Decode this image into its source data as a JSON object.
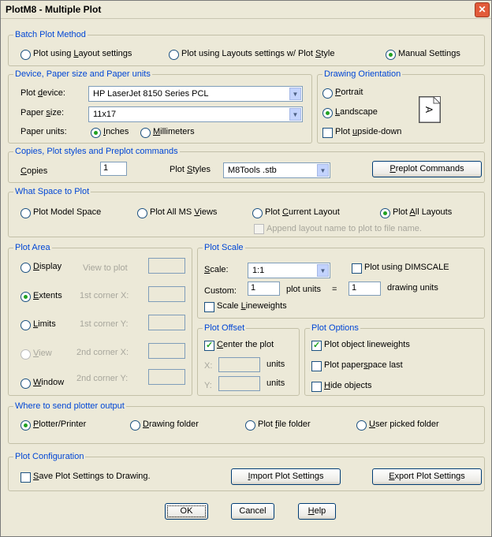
{
  "window": {
    "title": "PlotM8 - Multiple Plot"
  },
  "batch": {
    "legend": "Batch Plot Method",
    "opt1": [
      "Plot using ",
      "L",
      "ayout settings"
    ],
    "opt2": [
      "Plot using Layouts settings w/ Plot ",
      "S",
      "tyle"
    ],
    "opt3": "Manual Settings"
  },
  "device": {
    "legend": "Device, Paper size and Paper units",
    "plot_device_label": [
      "Plot ",
      "d",
      "evice:"
    ],
    "plot_device_value": "HP LaserJet 8150 Series PCL",
    "paper_size_label": [
      "Paper ",
      "s",
      "ize:"
    ],
    "paper_size_value": "11x17",
    "paper_units_label": "Paper units:",
    "inches": [
      "",
      "I",
      "nches"
    ],
    "millimeters": [
      "",
      "M",
      "illimeters"
    ]
  },
  "orientation": {
    "legend": "Drawing Orientation",
    "portrait": [
      "",
      "P",
      "ortrait"
    ],
    "landscape": [
      "",
      "L",
      "andscape"
    ],
    "upside_down": [
      "Plot ",
      "u",
      "pside-down"
    ],
    "icon_glyph": "A"
  },
  "copies": {
    "legend": "Copies, Plot styles and Preplot commands",
    "copies_label": [
      "",
      "C",
      "opies"
    ],
    "copies_value": "1",
    "styles_label": [
      "Plot ",
      "S",
      "tyles"
    ],
    "styles_value": "M8Tools .stb",
    "preplot": [
      "",
      "P",
      "replot Commands"
    ]
  },
  "space": {
    "legend": "What Space to Plot",
    "model": "Plot Model Space",
    "ms_views": [
      "Plot All MS ",
      "V",
      "iews"
    ],
    "current": [
      "Plot ",
      "C",
      "urrent Layout"
    ],
    "all": [
      "Plot ",
      "A",
      "ll Layouts"
    ],
    "append": "Append layout name to plot to file name."
  },
  "area": {
    "legend": "Plot Area",
    "display": [
      "",
      "D",
      "isplay"
    ],
    "extents": [
      "",
      "E",
      "xtents"
    ],
    "limits": [
      "",
      "L",
      "imits"
    ],
    "view": [
      "",
      "V",
      "iew"
    ],
    "window": [
      "",
      "W",
      "indow"
    ],
    "view_to_plot": "View to plot",
    "first_x": "1st corner X:",
    "first_y": "1st corner Y:",
    "second_x": "2nd corner X:",
    "second_y": "2nd corner Y:"
  },
  "scale": {
    "legend": "Plot Scale",
    "scale_label": [
      "",
      "S",
      "cale:"
    ],
    "scale_value": "1:1",
    "dimscale": "Plot using DIMSCALE",
    "custom_label": "Custom:",
    "custom_value": "1",
    "plot_units": "plot units",
    "equals": "=",
    "drawing_value": "1",
    "drawing_units": "drawing units",
    "lineweights": [
      "Scale ",
      "L",
      "ineweights"
    ]
  },
  "offset": {
    "legend": "Plot Offset",
    "center": [
      "",
      "C",
      "enter the plot"
    ],
    "x_label": "X:",
    "y_label": "Y:",
    "units": "units"
  },
  "options": {
    "legend": "Plot Options",
    "lineweights": "Plot object lineweights",
    "paperspace": [
      "Plot paper",
      "s",
      "pace last"
    ],
    "hide": [
      "",
      "H",
      "ide objects"
    ]
  },
  "output": {
    "legend": "Where to send plotter output",
    "printer": [
      "",
      "P",
      "lotter/Printer"
    ],
    "drawing_folder": [
      "",
      "D",
      "rawing folder"
    ],
    "file_folder": [
      "Plot ",
      "f",
      "ile folder"
    ],
    "user_folder": [
      "",
      "U",
      "ser picked folder"
    ]
  },
  "config": {
    "legend": "Plot Configuration",
    "save": [
      "",
      "S",
      "ave Plot Settings to Drawing."
    ],
    "import": [
      "",
      "I",
      "mport Plot Settings"
    ],
    "export": [
      "",
      "E",
      "xport Plot Settings"
    ]
  },
  "buttons": {
    "ok": "OK",
    "cancel": "Cancel",
    "help": [
      "",
      "H",
      "elp"
    ]
  }
}
